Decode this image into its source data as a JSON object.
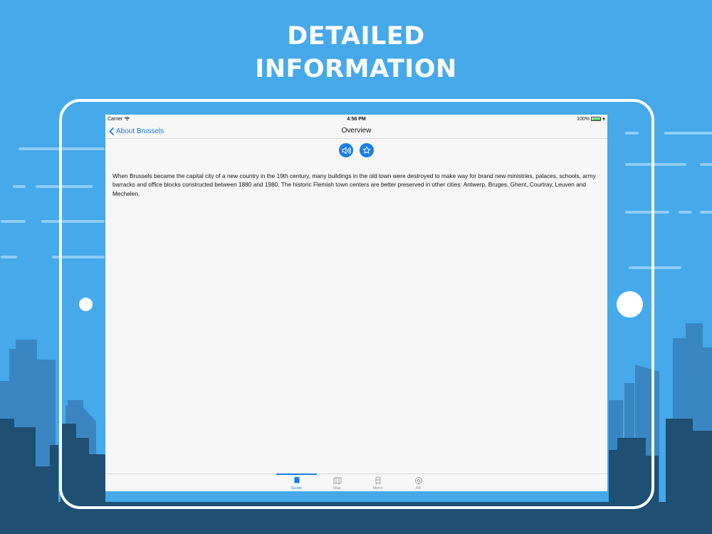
{
  "headline": {
    "line1": "DETAILED",
    "line2": "INFORMATION"
  },
  "status_bar": {
    "carrier": "Carrier",
    "time": "4:58 PM",
    "battery": "100%"
  },
  "nav_bar": {
    "back_label": "About Brussels",
    "title": "Overview"
  },
  "actions": [
    {
      "icon": "speaker-icon"
    },
    {
      "icon": "star-icon"
    }
  ],
  "content": {
    "paragraph": "When Brussels became the capital city of a new country in the 19th century, many buildings in the old town were destroyed to make way for brand new ministries, palaces, schools, army barracks and office blocks constructed between 1880 and 1980. The historic Flemish town centers are better preserved in other cities: Antwerp, Bruges, Ghent, Courtray, Leuven and Mechelen."
  },
  "tab_bar": {
    "items": [
      {
        "label": "Guide",
        "icon": "book-icon",
        "active": true
      },
      {
        "label": "Map",
        "icon": "map-icon",
        "active": false
      },
      {
        "label": "Metro",
        "icon": "train-icon",
        "active": false
      },
      {
        "label": "AR",
        "icon": "ar-gear-icon",
        "active": false
      }
    ]
  },
  "colors": {
    "background": "#45a9ea",
    "accent": "#1a7ee6",
    "skyline_light": "#3a86c2",
    "skyline_dark": "#1f4f73",
    "screen_bg": "#f7f7f7"
  }
}
